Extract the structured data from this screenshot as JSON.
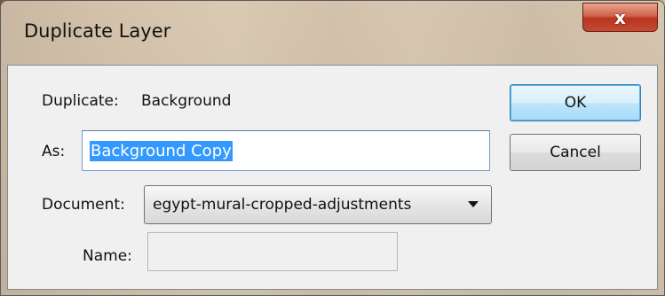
{
  "window": {
    "title": "Duplicate Layer",
    "close_glyph": "x"
  },
  "form": {
    "duplicate_label": "Duplicate:",
    "duplicate_value": "Background",
    "as_label": "As:",
    "as_value": "Background Copy",
    "document_label": "Document:",
    "document_value": "egypt-mural-cropped-adjustments",
    "name_label": "Name:",
    "name_value": ""
  },
  "buttons": {
    "ok_label": "OK",
    "cancel_label": "Cancel"
  }
}
